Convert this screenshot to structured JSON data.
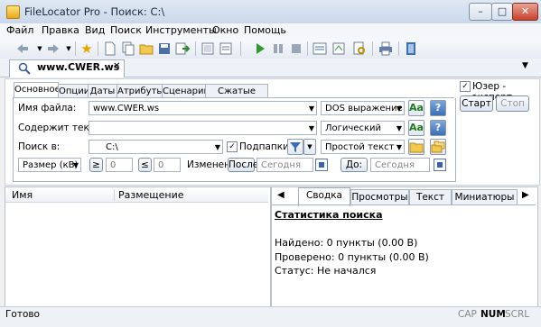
{
  "window": {
    "title": "FileLocator Pro - Поиск: C:\\",
    "min": "–",
    "max": "□",
    "close": "✕"
  },
  "menu": [
    "Файл",
    "Правка",
    "Вид",
    "Поиск",
    "Инструменты",
    "Окно",
    "Помощь"
  ],
  "doc_tab": {
    "label": "www.CWER.ws",
    "close": "✕",
    "dropdown": "▼"
  },
  "subtabs": [
    "Основное",
    "Опции",
    "Даты",
    "Атрибуты",
    "Сценарии",
    "Сжатые файлы"
  ],
  "form": {
    "filename_label": "Имя файла:",
    "filename_value": "www.CWER.ws",
    "filename_mode": "DOS выражение",
    "contains_label": "Содержит текст:",
    "contains_value": "",
    "contains_mode": "Логический",
    "searchin_label": "Поиск в:",
    "searchin_value": "C:\\",
    "subfolders_label": "Подпапки",
    "subfolders_checked": true,
    "searchin_mode": "Простой текст",
    "size_mode": "Размер (кВ)",
    "size_ge": "≥",
    "size_ge_value": "0",
    "size_le": "≤",
    "size_le_value": "0",
    "modified_label": "Изменен:",
    "after_label": "После:",
    "after_value": "Сегодня",
    "before_label": "До:",
    "before_value": "Сегодня",
    "aa": "Aa",
    "help": "?"
  },
  "expert": {
    "label": "Юзер - эксперт",
    "checked": true
  },
  "buttons": {
    "start": "Старт",
    "stop": "Стоп"
  },
  "results": {
    "columns": [
      "Имя",
      "Размещение"
    ]
  },
  "right_tabs": [
    "Сводка",
    "Просмотры",
    "Текст",
    "Миниатюры"
  ],
  "right_nav": {
    "prev": "◀",
    "next": "▶"
  },
  "summary": {
    "title": "Статистика поиска",
    "found": "Найдено: 0 пункты (0.00 В)",
    "checked": "Проверено: 0 пункты (0.00 В)",
    "status": "Статус: Не начался"
  },
  "status": {
    "text": "Готово",
    "cap": "CAP",
    "num": "NUM",
    "scrl": "SCRL"
  },
  "colors": {
    "accent": "#3a6fb7",
    "green_aa": "#1c7b1c",
    "title_bg": "#c9d8ea"
  }
}
